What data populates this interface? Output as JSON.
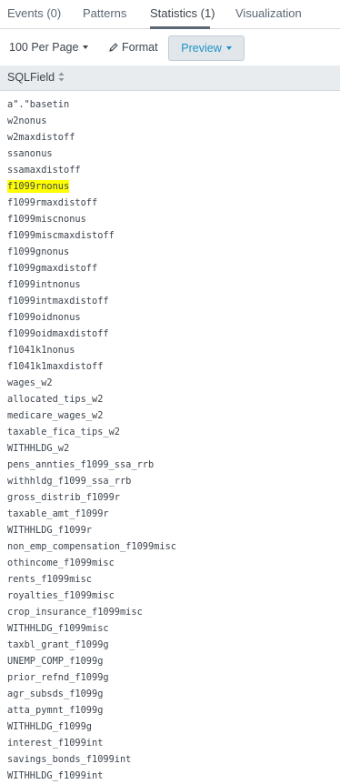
{
  "tabs": [
    {
      "label": "Events (0)"
    },
    {
      "label": "Patterns"
    },
    {
      "label": "Statistics (1)"
    },
    {
      "label": "Visualization"
    }
  ],
  "toolbar": {
    "per_page_label": "100 Per Page",
    "format_label": "Format",
    "preview_label": "Preview"
  },
  "table": {
    "column_header": "SQLField",
    "highlighted_row": "f1099rnonus",
    "rows": [
      "a\".\"basetin",
      "w2nonus",
      "w2maxdistoff",
      "ssanonus",
      "ssamaxdistoff",
      "f1099rnonus",
      "f1099rmaxdistoff",
      "f1099miscnonus",
      "f1099miscmaxdistoff",
      "f1099gnonus",
      "f1099gmaxdistoff",
      "f1099intnonus",
      "f1099intmaxdistoff",
      "f1099oidnonus",
      "f1099oidmaxdistoff",
      "f1041k1nonus",
      "f1041k1maxdistoff",
      "wages_w2",
      "allocated_tips_w2",
      "medicare_wages_w2",
      "taxable_fica_tips_w2",
      "WITHHLDG_w2",
      "pens_annties_f1099_ssa_rrb",
      "withhldg_f1099_ssa_rrb",
      "gross_distrib_f1099r",
      "taxable_amt_f1099r",
      "WITHHLDG_f1099r",
      "non_emp_compensation_f1099misc",
      "othincome_f1099misc",
      "rents_f1099misc",
      "royalties_f1099misc",
      "crop_insurance_f1099misc",
      "WITHHLDG_f1099misc",
      "taxbl_grant_f1099g",
      "UNEMP_COMP_f1099g",
      "prior_refnd_f1099g",
      "agr_subsds_f1099g",
      "atta_pymnt_f1099g",
      "WITHHLDG_f1099g",
      "interest_f1099int",
      "savings_bonds_f1099int",
      "WITHHLDG_f1099int"
    ]
  },
  "colors": {
    "accent": "#1e93c6",
    "highlight": "#ffff00",
    "header_bg": "#e9ecef",
    "text": "#3c444d"
  },
  "icons": {
    "per_page_caret": "chevron-down-icon",
    "format": "pencil-icon",
    "preview_caret": "chevron-down-icon",
    "sort": "sort-icon"
  }
}
